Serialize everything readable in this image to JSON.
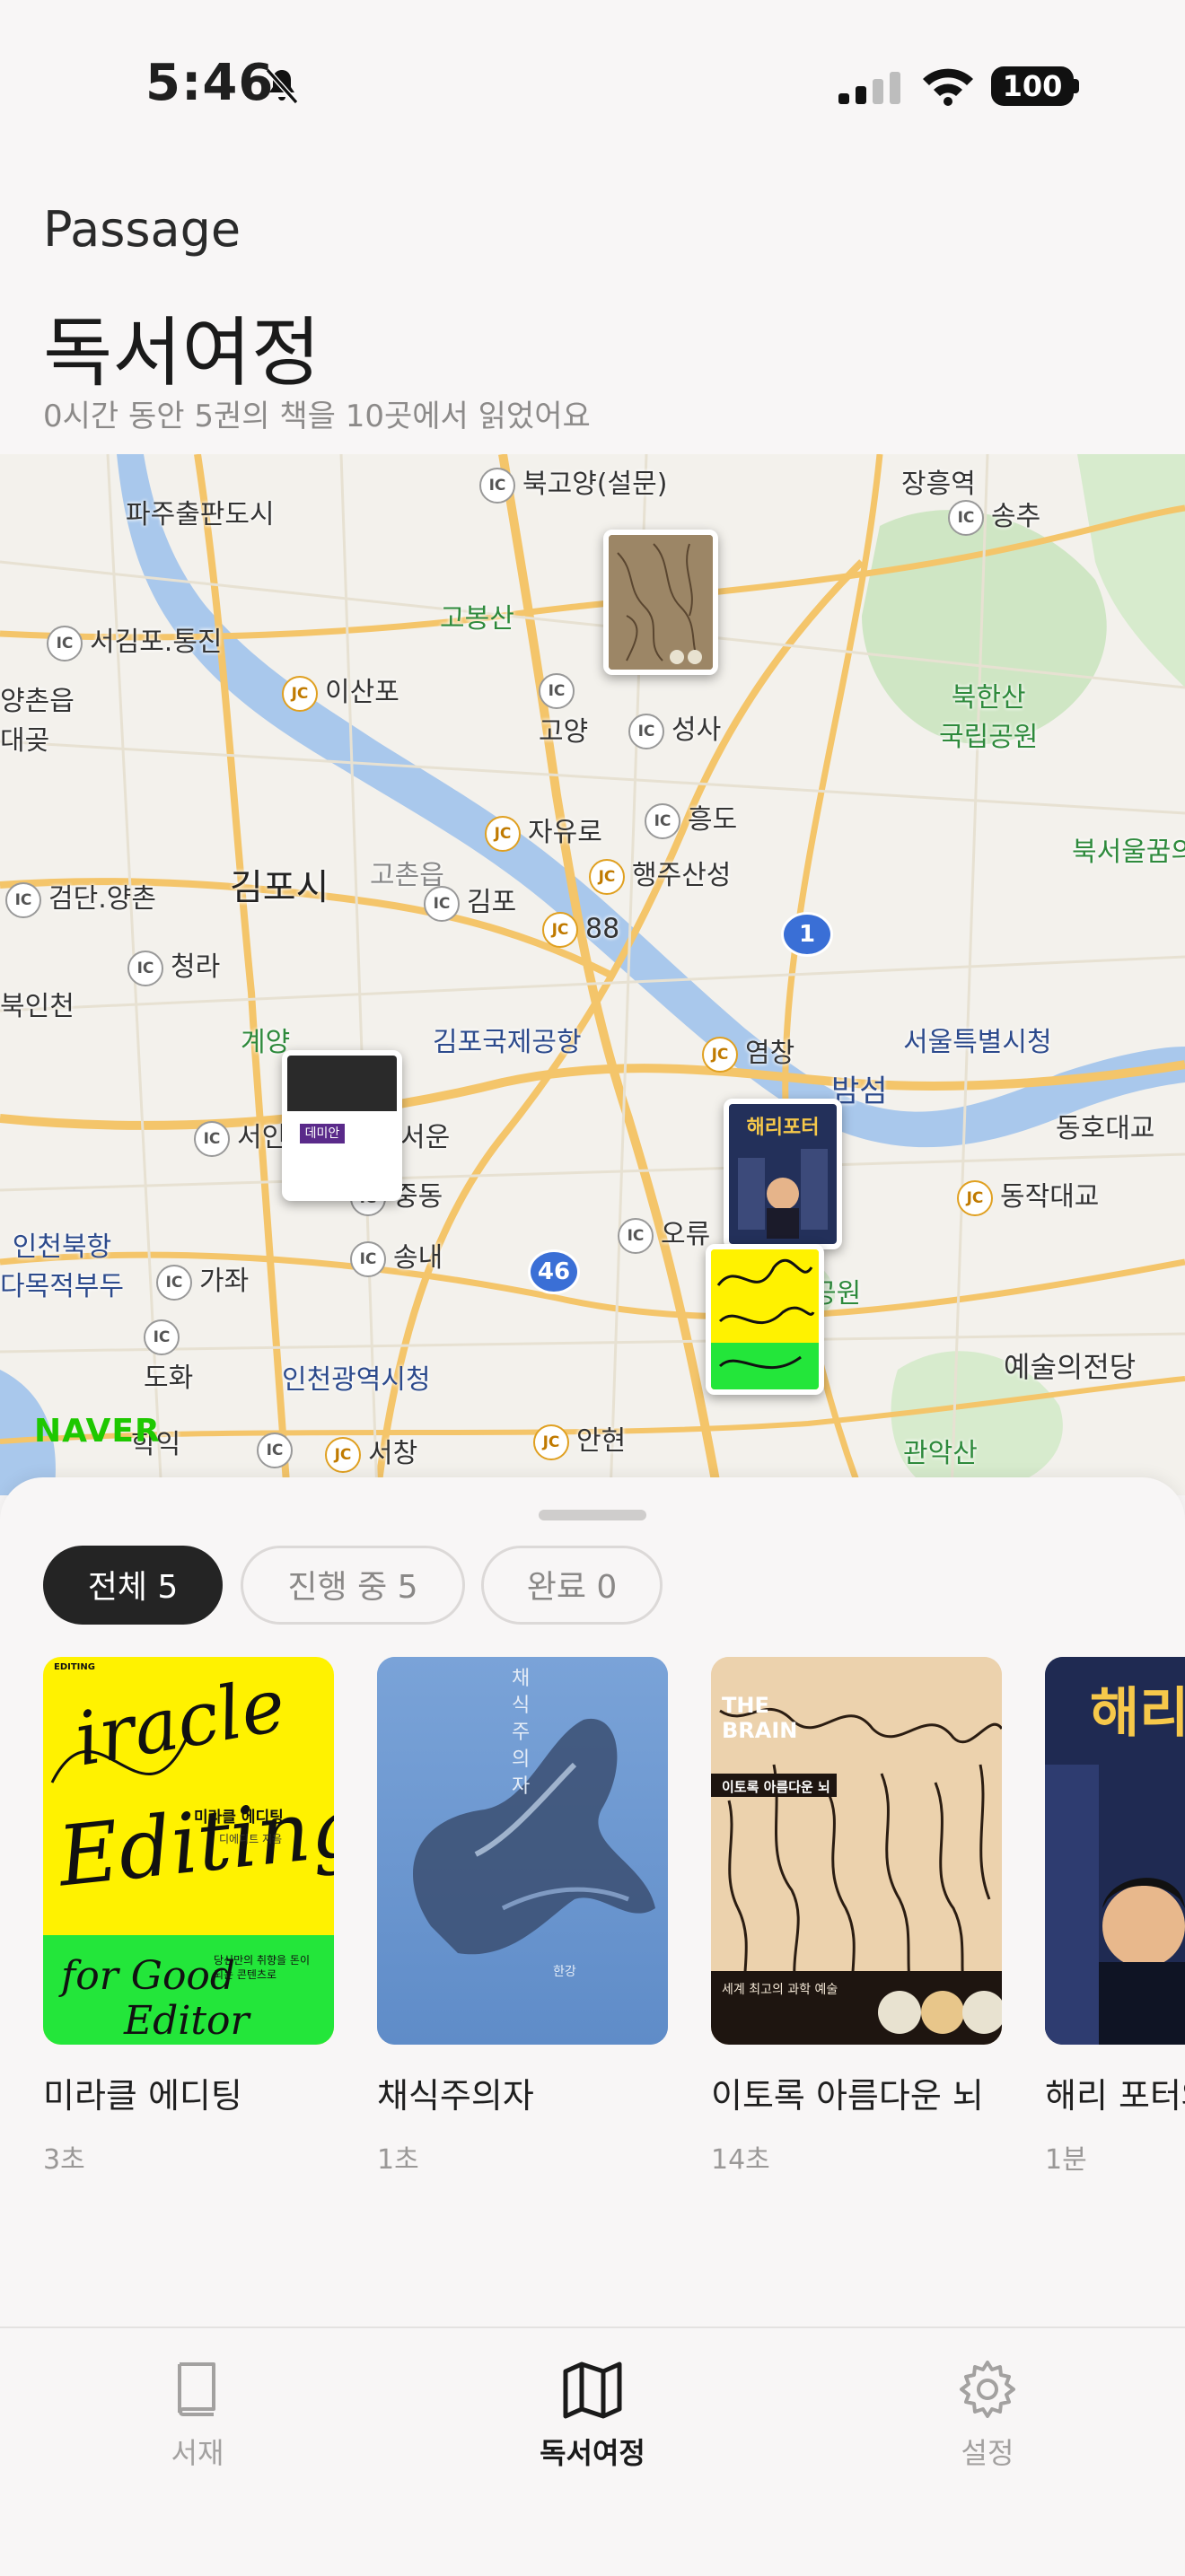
{
  "status": {
    "time": "5:46",
    "battery": "100"
  },
  "header": {
    "brand": "Passage",
    "title": "독서여정",
    "subtitle": "0시간 동안 5권의 책을 10곳에서 읽었어요"
  },
  "map": {
    "attribution": "NAVER",
    "labels": {
      "paju": "파주출판도시",
      "bukgoyang": "북고양(설문)",
      "jangheung": "장흥역",
      "songchu": "송추",
      "goBongsan": "고봉산",
      "bukhansan": "북한산\n국립공원",
      "seogimpo": "서김포.통진",
      "yangchon": "양촌읍\n대곶",
      "isan": "이산포",
      "goyang_ic": "고양",
      "seongsa": "성사",
      "heungdo": "흥도",
      "jayuro": "자유로",
      "haengjusan": "행주산성",
      "gimpo_city": "김포시",
      "gochon": "고촌읍",
      "gimpo_ic": "김포",
      "geomdan": "검단.양촌",
      "bukseoul": "북서울꿈의",
      "jc88": "88",
      "cheongra": "청라",
      "gimpo_airport": "김포국제공항",
      "bukincheon": "북인천",
      "gyeyang": "계양",
      "yeomchang": "염창",
      "seoul_cityhall": "서울특별시청",
      "bamseom": "밤섬",
      "seoin": "서인",
      "seoun": "서운",
      "jungdong": "중동",
      "dongho": "동호대교",
      "dongjak": "동작대교",
      "incheon_north": "인천북항\n다목적부두",
      "gaja": "가좌",
      "songnae": "송내",
      "oryu": "오류",
      "park": "공원",
      "arts": "예술의전당",
      "doha": "도화",
      "incheon_cityhall": "인천광역시청",
      "hagik": "학익",
      "seochang": "서창",
      "anhyeon": "안현",
      "gwanaksan": "관악산",
      "route1": "1",
      "route46": "46"
    }
  },
  "filters": [
    {
      "label": "전체 5",
      "active": true
    },
    {
      "label": "진행 중 5",
      "active": false
    },
    {
      "label": "완료 0",
      "active": false
    }
  ],
  "books": [
    {
      "title": "미라클 에디팅",
      "time": "3초",
      "cover_text": "Miracle Editing",
      "cover_sub": "미라클 에디팅",
      "cover_author": "디에디트 지음",
      "cover_tagline": "당신만의 취향을 돈이 되는 콘텐츠로",
      "cover_bottom": "for Good Editor",
      "cover_brand": "EDITING"
    },
    {
      "title": "채식주의자",
      "time": "1초",
      "cover_text": "채식주의자",
      "cover_author": "한강"
    },
    {
      "title": "이토록 아름다운 뇌",
      "time": "14초",
      "cover_text": "THE BRAIN",
      "cover_sub": "이토록 아름다운 뇌",
      "cover_tagline": "세계 최고의 과학 예술"
    },
    {
      "title": "해리 포터와",
      "time": "1분",
      "cover_text": "해리"
    }
  ],
  "markers": {
    "harry": "해리포터",
    "demian": "데미안"
  },
  "tabs": [
    {
      "label": "서재",
      "active": false
    },
    {
      "label": "독서여정",
      "active": true
    },
    {
      "label": "설정",
      "active": false
    }
  ],
  "colors": {
    "accent": "#242424",
    "map_water": "#a9c8ec",
    "map_road": "#f4c56a",
    "map_park": "#cfe6c4"
  }
}
